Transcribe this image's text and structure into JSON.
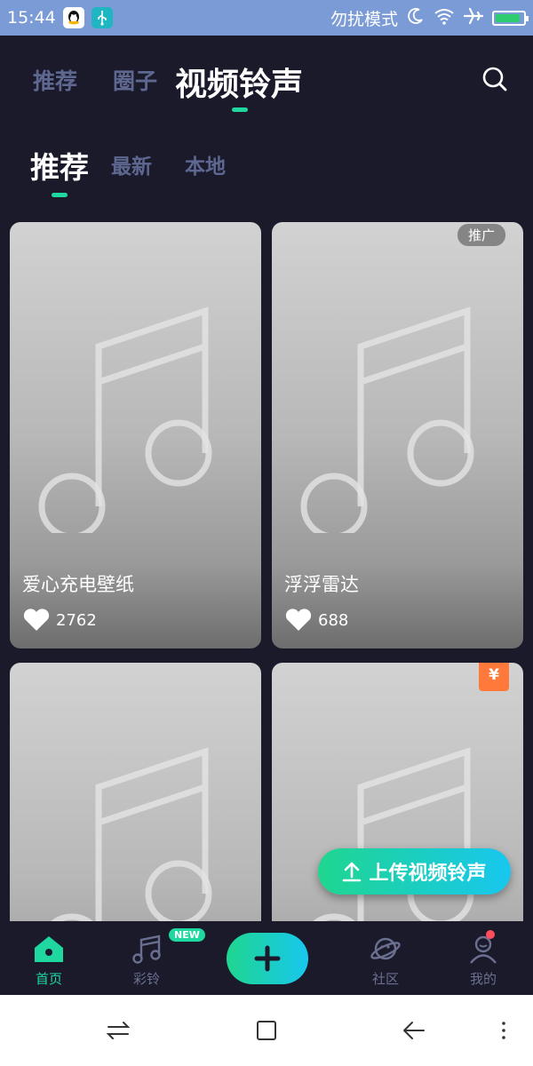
{
  "status_bar": {
    "time": "15:44",
    "dnd_label": "勿扰模式",
    "battery_level": 0.9,
    "colors": {
      "background": "#7b9bd6"
    }
  },
  "top_tabs": [
    {
      "label": "推荐",
      "active": false
    },
    {
      "label": "圈子",
      "active": false
    },
    {
      "label": "视频铃声",
      "active": true
    }
  ],
  "sub_tabs": [
    {
      "label": "推荐",
      "active": true
    },
    {
      "label": "最新",
      "active": false
    },
    {
      "label": "本地",
      "active": false
    }
  ],
  "cards": [
    {
      "title": "爱心充电壁纸",
      "likes": "2762",
      "badge": ""
    },
    {
      "title": "浮浮雷达",
      "likes": "688",
      "badge": "推广"
    },
    {
      "title": "",
      "likes": "",
      "badge": ""
    },
    {
      "title": "",
      "likes": "",
      "badge": "¥"
    }
  ],
  "upload_button": {
    "label": "上传视频铃声",
    "icon": "upload-arrow-icon"
  },
  "bottom_nav": {
    "items": [
      {
        "label": "首页",
        "icon": "home-icon",
        "active": true
      },
      {
        "label": "彩铃",
        "icon": "music-note-icon",
        "active": false,
        "badge": "NEW"
      },
      {
        "label": "",
        "icon": "plus-icon",
        "active": false
      },
      {
        "label": "社区",
        "icon": "planet-icon",
        "active": false
      },
      {
        "label": "我的",
        "icon": "profile-icon",
        "active": false
      }
    ]
  },
  "colors": {
    "background": "#1a1a2b",
    "accent": "#1fd8a0",
    "inactive_tab": "#5d6790",
    "promo_orange": "#ff7a3a"
  }
}
